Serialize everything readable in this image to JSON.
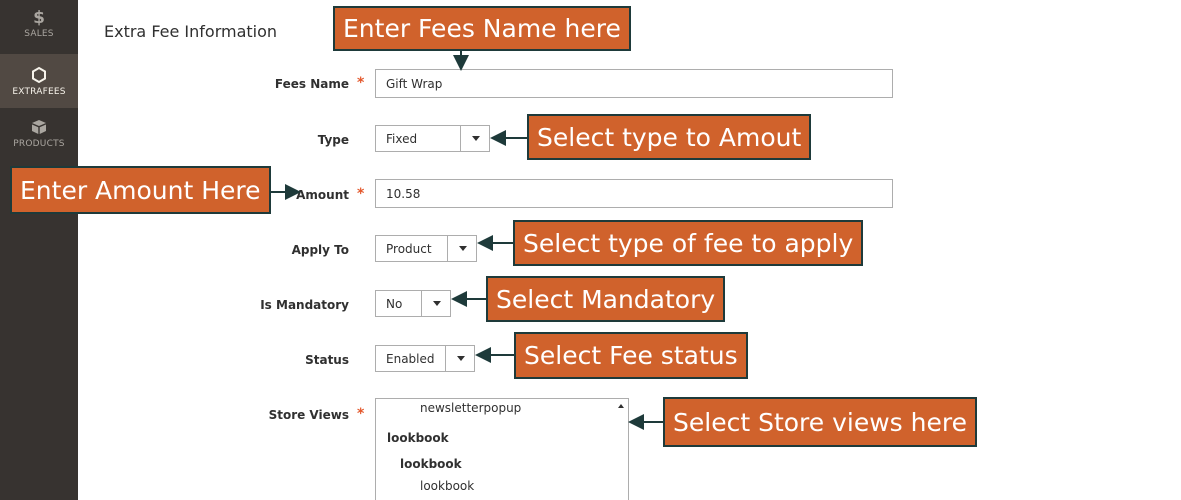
{
  "sidebar": {
    "items": [
      {
        "label": "SALES",
        "icon": "dollar-icon"
      },
      {
        "label": "EXTRAFEES",
        "icon": "hexagon-icon",
        "active": true
      },
      {
        "label": "PRODUCTS",
        "icon": "box-icon"
      }
    ]
  },
  "section_title": "Extra Fee Information",
  "form": {
    "fees_name": {
      "label": "Fees Name",
      "value": "Gift Wrap",
      "required": true
    },
    "type": {
      "label": "Type",
      "value": "Fixed"
    },
    "amount": {
      "label": "Amount",
      "value": "10.58",
      "required": true
    },
    "apply_to": {
      "label": "Apply To",
      "value": "Product"
    },
    "is_mandatory": {
      "label": "Is Mandatory",
      "value": "No"
    },
    "status": {
      "label": "Status",
      "value": "Enabled"
    },
    "store_views": {
      "label": "Store Views",
      "required": true,
      "options": [
        "newsletterpopup",
        "lookbook",
        "lookbook",
        "lookbook"
      ]
    }
  },
  "annotations": {
    "fees_name": "Enter Fees Name here",
    "type": "Select type to Amout",
    "amount": "Enter Amount Here",
    "apply_to": "Select type of fee to apply",
    "mandatory": "Select Mandatory",
    "status": "Select Fee status",
    "store_views": "Select Store views here"
  },
  "colors": {
    "sidebar_bg": "#373330",
    "sidebar_active": "#514943",
    "required_star": "#e3572b",
    "callout_bg": "#d0622c",
    "callout_border": "#1e3a3a"
  }
}
